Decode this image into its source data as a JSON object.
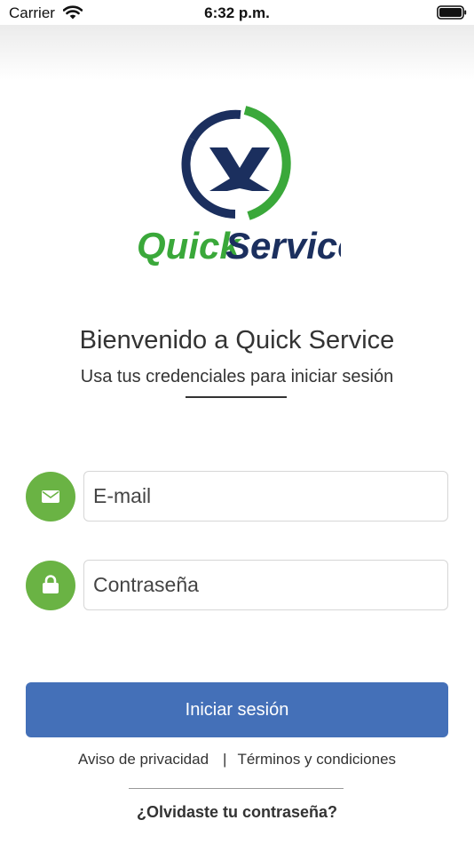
{
  "status_bar": {
    "carrier": "Carrier",
    "time": "6:32 p.m.",
    "icons": [
      "wifi-icon",
      "battery-icon"
    ]
  },
  "logo": {
    "word_green": "Quick",
    "word_blue": "Service",
    "mark_letter": "X"
  },
  "welcome": {
    "title": "Bienvenido a Quick Service",
    "subtitle": "Usa tus credenciales para iniciar sesión"
  },
  "form": {
    "email": {
      "placeholder": "E-mail",
      "value": "",
      "icon": "envelope-icon"
    },
    "password": {
      "placeholder": "Contraseña",
      "value": "",
      "icon": "lock-icon"
    },
    "submit_label": "Iniciar sesión"
  },
  "footer": {
    "privacy_label": "Aviso de privacidad",
    "separator": "|",
    "terms_label": "Términos y condiciones",
    "forgot_label": "¿Olvidaste tu contraseña?"
  },
  "colors": {
    "accent_green": "#6ab344",
    "logo_green": "#3aa83a",
    "logo_navy": "#1b2f5e",
    "button_blue": "#4470b8"
  }
}
